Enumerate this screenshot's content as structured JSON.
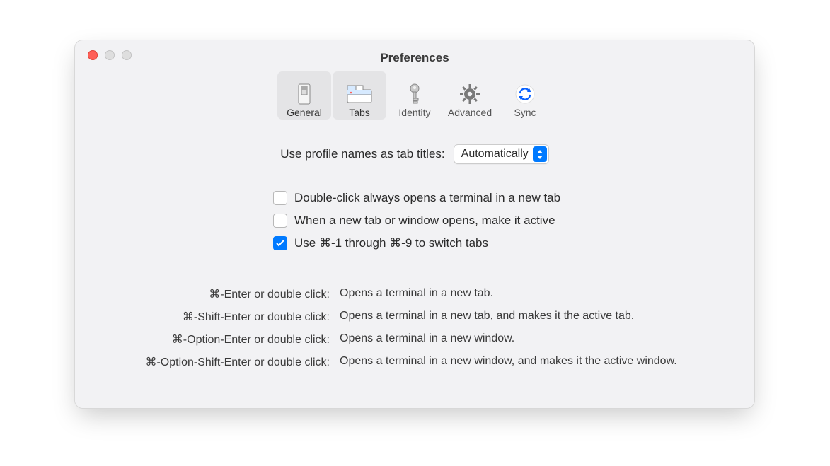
{
  "window": {
    "title": "Preferences"
  },
  "toolbar": {
    "items": [
      {
        "id": "general",
        "label": "General"
      },
      {
        "id": "tabs",
        "label": "Tabs"
      },
      {
        "id": "identity",
        "label": "Identity"
      },
      {
        "id": "advanced",
        "label": "Advanced"
      },
      {
        "id": "sync",
        "label": "Sync"
      }
    ],
    "selected": "tabs"
  },
  "content": {
    "profile_names_label": "Use profile names as tab titles:",
    "profile_names_value": "Automatically",
    "checkboxes": {
      "double_click": {
        "checked": false,
        "label": "Double-click always opens a terminal in a new tab"
      },
      "make_active": {
        "checked": false,
        "label": "When a new tab or window opens, make it active"
      },
      "cmd_switch": {
        "checked": true,
        "label": "Use ⌘-1 through ⌘-9 to switch tabs"
      }
    },
    "shortcuts": [
      {
        "key": "⌘-Enter or double click:",
        "desc": "Opens a terminal in a new tab."
      },
      {
        "key": "⌘-Shift-Enter or double click:",
        "desc": "Opens a terminal in a new tab, and makes it the active tab."
      },
      {
        "key": "⌘-Option-Enter or double click:",
        "desc": "Opens a terminal in a new window."
      },
      {
        "key": "⌘-Option-Shift-Enter or double click:",
        "desc": "Opens a terminal in a new window, and makes it the active window."
      }
    ]
  }
}
